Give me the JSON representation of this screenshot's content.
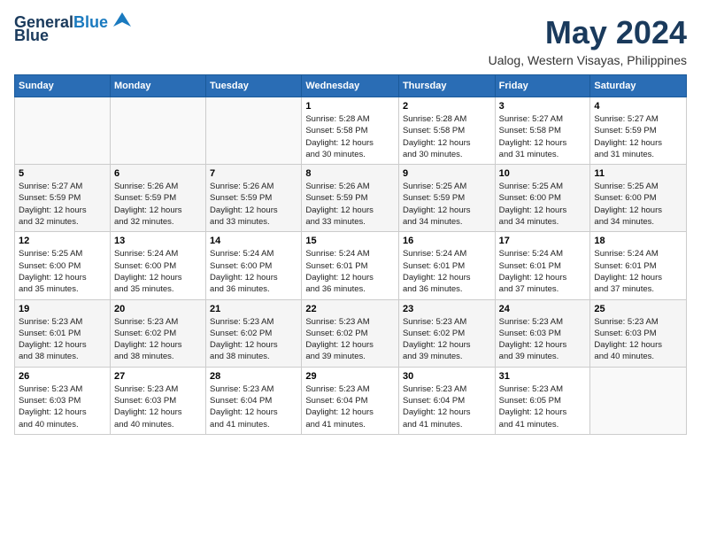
{
  "header": {
    "logo_line1": "General",
    "logo_line2": "Blue",
    "title": "May 2024",
    "location": "Ualog, Western Visayas, Philippines"
  },
  "weekdays": [
    "Sunday",
    "Monday",
    "Tuesday",
    "Wednesday",
    "Thursday",
    "Friday",
    "Saturday"
  ],
  "weeks": [
    [
      {
        "day": "",
        "info": ""
      },
      {
        "day": "",
        "info": ""
      },
      {
        "day": "",
        "info": ""
      },
      {
        "day": "1",
        "info": "Sunrise: 5:28 AM\nSunset: 5:58 PM\nDaylight: 12 hours\nand 30 minutes."
      },
      {
        "day": "2",
        "info": "Sunrise: 5:28 AM\nSunset: 5:58 PM\nDaylight: 12 hours\nand 30 minutes."
      },
      {
        "day": "3",
        "info": "Sunrise: 5:27 AM\nSunset: 5:58 PM\nDaylight: 12 hours\nand 31 minutes."
      },
      {
        "day": "4",
        "info": "Sunrise: 5:27 AM\nSunset: 5:59 PM\nDaylight: 12 hours\nand 31 minutes."
      }
    ],
    [
      {
        "day": "5",
        "info": "Sunrise: 5:27 AM\nSunset: 5:59 PM\nDaylight: 12 hours\nand 32 minutes."
      },
      {
        "day": "6",
        "info": "Sunrise: 5:26 AM\nSunset: 5:59 PM\nDaylight: 12 hours\nand 32 minutes."
      },
      {
        "day": "7",
        "info": "Sunrise: 5:26 AM\nSunset: 5:59 PM\nDaylight: 12 hours\nand 33 minutes."
      },
      {
        "day": "8",
        "info": "Sunrise: 5:26 AM\nSunset: 5:59 PM\nDaylight: 12 hours\nand 33 minutes."
      },
      {
        "day": "9",
        "info": "Sunrise: 5:25 AM\nSunset: 5:59 PM\nDaylight: 12 hours\nand 34 minutes."
      },
      {
        "day": "10",
        "info": "Sunrise: 5:25 AM\nSunset: 6:00 PM\nDaylight: 12 hours\nand 34 minutes."
      },
      {
        "day": "11",
        "info": "Sunrise: 5:25 AM\nSunset: 6:00 PM\nDaylight: 12 hours\nand 34 minutes."
      }
    ],
    [
      {
        "day": "12",
        "info": "Sunrise: 5:25 AM\nSunset: 6:00 PM\nDaylight: 12 hours\nand 35 minutes."
      },
      {
        "day": "13",
        "info": "Sunrise: 5:24 AM\nSunset: 6:00 PM\nDaylight: 12 hours\nand 35 minutes."
      },
      {
        "day": "14",
        "info": "Sunrise: 5:24 AM\nSunset: 6:00 PM\nDaylight: 12 hours\nand 36 minutes."
      },
      {
        "day": "15",
        "info": "Sunrise: 5:24 AM\nSunset: 6:01 PM\nDaylight: 12 hours\nand 36 minutes."
      },
      {
        "day": "16",
        "info": "Sunrise: 5:24 AM\nSunset: 6:01 PM\nDaylight: 12 hours\nand 36 minutes."
      },
      {
        "day": "17",
        "info": "Sunrise: 5:24 AM\nSunset: 6:01 PM\nDaylight: 12 hours\nand 37 minutes."
      },
      {
        "day": "18",
        "info": "Sunrise: 5:24 AM\nSunset: 6:01 PM\nDaylight: 12 hours\nand 37 minutes."
      }
    ],
    [
      {
        "day": "19",
        "info": "Sunrise: 5:23 AM\nSunset: 6:01 PM\nDaylight: 12 hours\nand 38 minutes."
      },
      {
        "day": "20",
        "info": "Sunrise: 5:23 AM\nSunset: 6:02 PM\nDaylight: 12 hours\nand 38 minutes."
      },
      {
        "day": "21",
        "info": "Sunrise: 5:23 AM\nSunset: 6:02 PM\nDaylight: 12 hours\nand 38 minutes."
      },
      {
        "day": "22",
        "info": "Sunrise: 5:23 AM\nSunset: 6:02 PM\nDaylight: 12 hours\nand 39 minutes."
      },
      {
        "day": "23",
        "info": "Sunrise: 5:23 AM\nSunset: 6:02 PM\nDaylight: 12 hours\nand 39 minutes."
      },
      {
        "day": "24",
        "info": "Sunrise: 5:23 AM\nSunset: 6:03 PM\nDaylight: 12 hours\nand 39 minutes."
      },
      {
        "day": "25",
        "info": "Sunrise: 5:23 AM\nSunset: 6:03 PM\nDaylight: 12 hours\nand 40 minutes."
      }
    ],
    [
      {
        "day": "26",
        "info": "Sunrise: 5:23 AM\nSunset: 6:03 PM\nDaylight: 12 hours\nand 40 minutes."
      },
      {
        "day": "27",
        "info": "Sunrise: 5:23 AM\nSunset: 6:03 PM\nDaylight: 12 hours\nand 40 minutes."
      },
      {
        "day": "28",
        "info": "Sunrise: 5:23 AM\nSunset: 6:04 PM\nDaylight: 12 hours\nand 41 minutes."
      },
      {
        "day": "29",
        "info": "Sunrise: 5:23 AM\nSunset: 6:04 PM\nDaylight: 12 hours\nand 41 minutes."
      },
      {
        "day": "30",
        "info": "Sunrise: 5:23 AM\nSunset: 6:04 PM\nDaylight: 12 hours\nand 41 minutes."
      },
      {
        "day": "31",
        "info": "Sunrise: 5:23 AM\nSunset: 6:05 PM\nDaylight: 12 hours\nand 41 minutes."
      },
      {
        "day": "",
        "info": ""
      }
    ]
  ]
}
